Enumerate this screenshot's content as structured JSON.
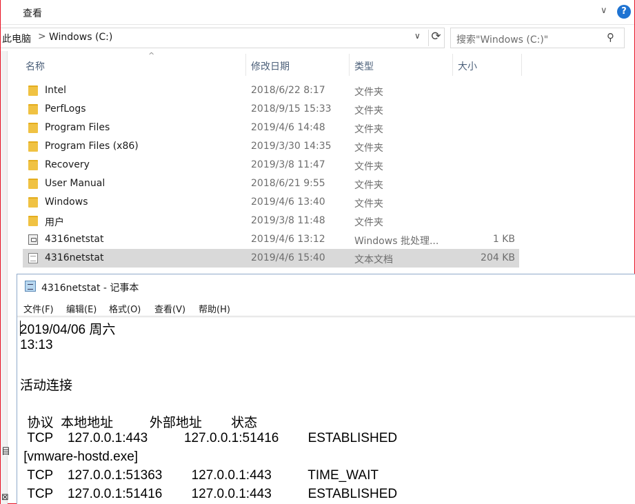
{
  "ribbon": {
    "tab_label": "查看",
    "collapse_glyph": "∨",
    "help_glyph": "?"
  },
  "address": {
    "crumbs": [
      "此电脑",
      "Windows (C:)"
    ],
    "separator": ">",
    "dropdown_glyph": "∨",
    "refresh_glyph": "⟳"
  },
  "search": {
    "placeholder": "搜索\"Windows (C:)\"",
    "icon_glyph": "⚲"
  },
  "nav_strip": {
    "glyphs": [
      "目",
      "⊠"
    ]
  },
  "columns": {
    "name": "名称",
    "date": "修改日期",
    "type": "类型",
    "size": "大小",
    "sort_glyph": "^"
  },
  "files": [
    {
      "name": "Intel",
      "date": "2018/6/22 8:17",
      "type": "文件夹",
      "size": "",
      "icon": "folder-icon"
    },
    {
      "name": "PerfLogs",
      "date": "2018/9/15 15:33",
      "type": "文件夹",
      "size": "",
      "icon": "folder-icon"
    },
    {
      "name": "Program Files",
      "date": "2019/4/6 14:48",
      "type": "文件夹",
      "size": "",
      "icon": "folder-icon"
    },
    {
      "name": "Program Files (x86)",
      "date": "2019/3/30 14:35",
      "type": "文件夹",
      "size": "",
      "icon": "folder-icon"
    },
    {
      "name": "Recovery",
      "date": "2019/3/8 11:47",
      "type": "文件夹",
      "size": "",
      "icon": "folder-icon"
    },
    {
      "name": "User Manual",
      "date": "2018/6/21 9:55",
      "type": "文件夹",
      "size": "",
      "icon": "folder-icon"
    },
    {
      "name": "Windows",
      "date": "2019/4/6 13:40",
      "type": "文件夹",
      "size": "",
      "icon": "folder-icon"
    },
    {
      "name": "用户",
      "date": "2019/3/8 11:48",
      "type": "文件夹",
      "size": "",
      "icon": "folder-icon"
    },
    {
      "name": "4316netstat",
      "date": "2019/4/6 13:12",
      "type": "Windows 批处理...",
      "size": "1 KB",
      "icon": "batch-file-icon"
    },
    {
      "name": "4316netstat",
      "date": "2019/4/6 15:40",
      "type": "文本文档",
      "size": "204 KB",
      "icon": "text-file-icon",
      "selected": true
    }
  ],
  "notepad": {
    "title": "4316netstat - 记事本",
    "menu": [
      "文件(F)",
      "编辑(E)",
      "格式(O)",
      "查看(V)",
      "帮助(H)"
    ],
    "lines": [
      "2019/04/06 周六",
      "13:13",
      "",
      "活动连接",
      "",
      "  协议  本地地址          外部地址        状态",
      "  TCP    127.0.0.1:443          127.0.0.1:51416        ESTABLISHED",
      " [vmware-hostd.exe]",
      "  TCP    127.0.0.1:51363        127.0.0.1:443          TIME_WAIT",
      "  TCP    127.0.0.1:51416        127.0.0.1:443          ESTABLISHED"
    ]
  }
}
